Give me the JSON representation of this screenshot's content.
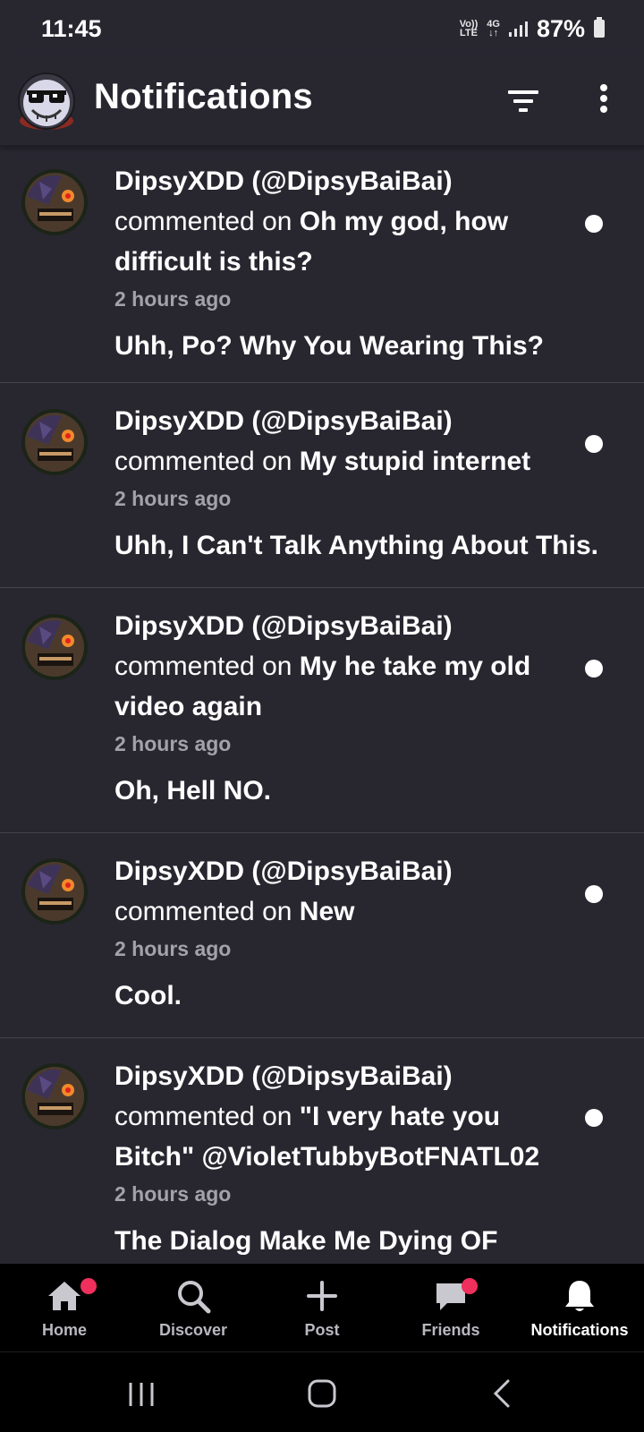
{
  "status_bar": {
    "time": "11:45",
    "volte_top": "Vo))",
    "volte_bottom": "LTE",
    "network_top": "4G",
    "network_bottom": "↓↑",
    "battery": "87%"
  },
  "header": {
    "title": "Notifications",
    "logo_icon": "app-logo-icon",
    "filter_icon": "filter-icon",
    "more_icon": "more-vertical-icon"
  },
  "notifications": [
    {
      "user": "DipsyXDD (@DipsyBaiBai)",
      "action": "commented on ",
      "post_line1": "Oh my god, how",
      "post_line2": "difficult is this?",
      "time": "2 hours ago",
      "comment": "Uhh, Po? Why You Wearing This?",
      "unread": true
    },
    {
      "user": "DipsyXDD (@DipsyBaiBai)",
      "action": "commented on ",
      "post_line1": "My stupid internet",
      "post_line2": "",
      "time": "2 hours ago",
      "comment": "Uhh, I Can't Talk Anything About This.",
      "unread": true
    },
    {
      "user": "DipsyXDD (@DipsyBaiBai)",
      "action": "commented on ",
      "post_line1": "My he take my old",
      "post_line2": "video again",
      "time": "2 hours ago",
      "comment": "Oh, Hell NO.",
      "unread": true
    },
    {
      "user": "DipsyXDD (@DipsyBaiBai)",
      "action": "commented on ",
      "post_line1": "New",
      "post_line2": "",
      "time": "2 hours ago",
      "comment": "Cool.",
      "unread": true
    },
    {
      "user": "DipsyXDD (@DipsyBaiBai)",
      "action": "commented on ",
      "post_line1": "\"I very hate you",
      "post_line2": "Bitch\" @VioletTubbyBotFNATL02",
      "time": "2 hours ago",
      "comment": "The Dialog Make Me Dying OF",
      "unread": true
    }
  ],
  "bottom_nav": [
    {
      "label": "Home",
      "icon": "home-icon",
      "badge": true,
      "active": false
    },
    {
      "label": "Discover",
      "icon": "search-icon",
      "badge": false,
      "active": false
    },
    {
      "label": "Post",
      "icon": "plus-icon",
      "badge": false,
      "active": false
    },
    {
      "label": "Friends",
      "icon": "chat-bubble-icon",
      "badge": true,
      "active": false
    },
    {
      "label": "Notifications",
      "icon": "bell-icon",
      "badge": false,
      "active": true
    }
  ],
  "colors": {
    "background": "#282730",
    "nav_background": "#000000",
    "badge": "#ef2f5c",
    "secondary_text": "#a3a2ab"
  }
}
